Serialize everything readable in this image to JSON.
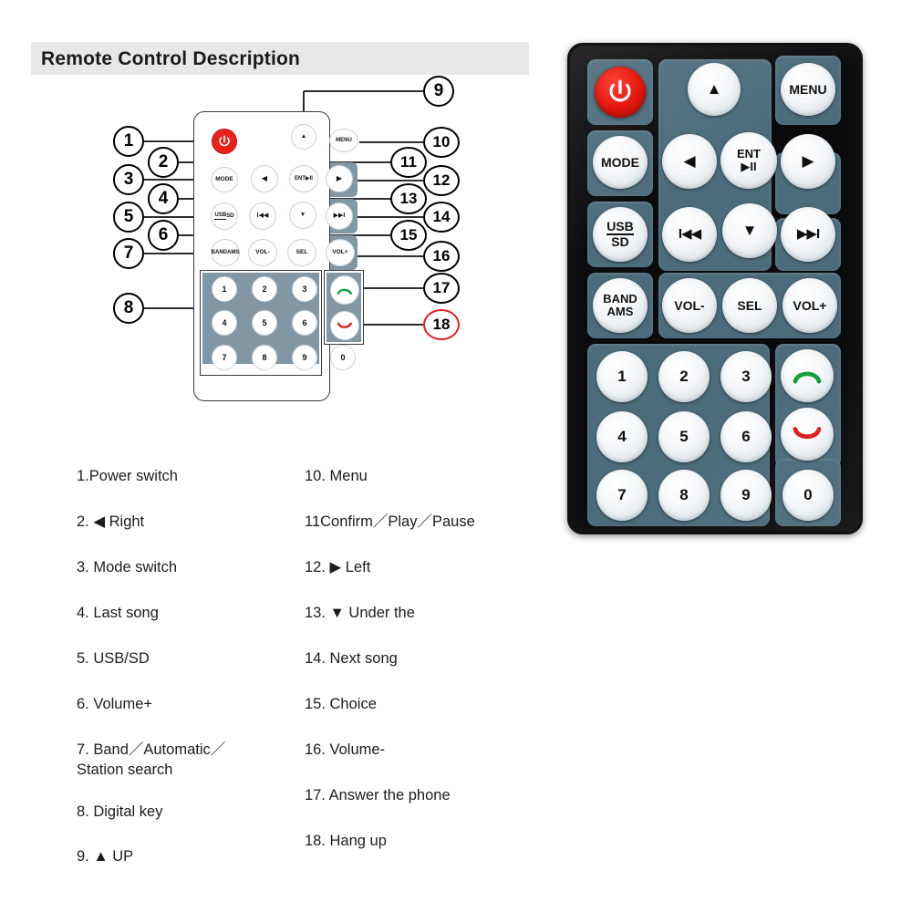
{
  "header": {
    "title": "Remote Control Description"
  },
  "diagram": {
    "name": "remote-control-callout-diagram",
    "buttons": {
      "power": "",
      "up": "▲",
      "menu": "MENU",
      "mode": "MODE",
      "left": "◀",
      "ent_line1": "ENT",
      "ent_line2": "▶II",
      "right": "▶",
      "usbsd_line1": "USB",
      "usbsd_line2": "SD",
      "prev": "I◀◀",
      "down": "▼",
      "next": "▶▶I",
      "band_line1": "BAND",
      "band_line2": "AMS",
      "volminus": "VOL-",
      "sel": "SEL",
      "volplus": "VOL+"
    },
    "keypad": [
      "1",
      "2",
      "3",
      "4",
      "5",
      "6",
      "7",
      "8",
      "9",
      "0"
    ],
    "phone": {
      "answer": "answer-call",
      "hangup": "hang-up-call"
    },
    "callouts": [
      {
        "n": "1"
      },
      {
        "n": "2"
      },
      {
        "n": "3"
      },
      {
        "n": "4"
      },
      {
        "n": "5"
      },
      {
        "n": "6"
      },
      {
        "n": "7"
      },
      {
        "n": "8"
      },
      {
        "n": "9"
      },
      {
        "n": "10"
      },
      {
        "n": "11"
      },
      {
        "n": "12"
      },
      {
        "n": "13"
      },
      {
        "n": "14"
      },
      {
        "n": "15"
      },
      {
        "n": "16"
      },
      {
        "n": "17"
      },
      {
        "n": "18"
      }
    ]
  },
  "legend": {
    "left": [
      "1.Power switch",
      "2. ◀ Right",
      "3. Mode switch",
      "4. Last song",
      "5. USB/SD",
      "6. Volume+",
      "7. Band／Automatic／\n    Station search",
      "8. Digital key",
      "9. ▲ UP"
    ],
    "right": [
      "10. Menu",
      "11Confirm／Play／Pause",
      "12.  ▶  Left",
      "13.  ▼  Under the",
      "14. Next song",
      "15. Choice",
      "16. Volume-",
      "17. Answer the phone",
      "18. Hang up"
    ]
  },
  "photo": {
    "name": "remote-control-photograph",
    "buttons": {
      "power": "",
      "up": "▲",
      "menu": "MENU",
      "mode": "MODE",
      "left": "◀",
      "ent_line1": "ENT",
      "ent_line2": "▶II",
      "right": "▶",
      "usbsd_line1": "USB",
      "usbsd_line2": "SD",
      "prev": "I◀◀",
      "down": "▼",
      "next": "▶▶I",
      "band_line1": "BAND",
      "band_line2": "AMS",
      "volminus": "VOL-",
      "sel": "SEL",
      "volplus": "VOL+"
    },
    "keypad": [
      "1",
      "2",
      "3",
      "4",
      "5",
      "6",
      "7",
      "8",
      "9",
      "0"
    ]
  },
  "colors": {
    "header_bg": "#e8e8e8",
    "diagram_pad": "#8296a4",
    "photo_body": "#0b0b0d",
    "photo_pad": "#4c6c7c",
    "power_red": "#e3170d",
    "answer_green": "#12a03c",
    "hangup_red": "#e02020",
    "callout_red": "#e02020"
  }
}
